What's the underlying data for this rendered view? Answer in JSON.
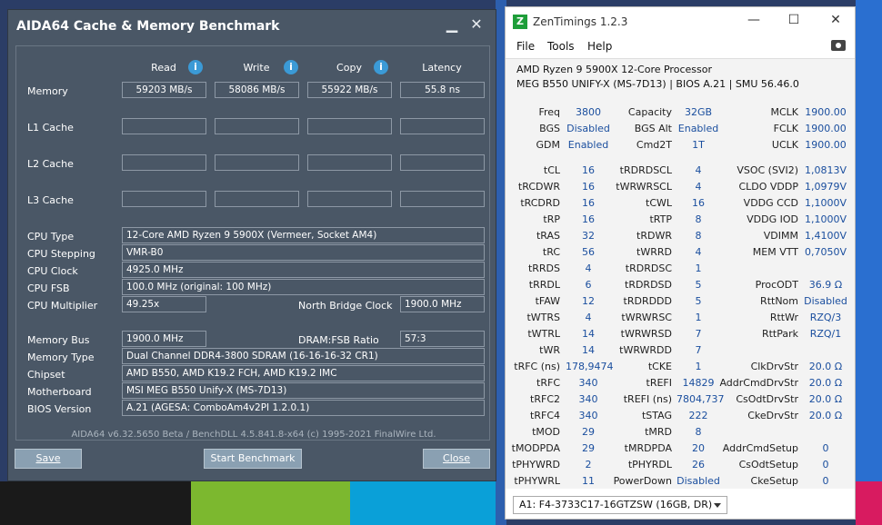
{
  "aida": {
    "title": "AIDA64 Cache & Memory Benchmark",
    "columns": [
      "Read",
      "Write",
      "Copy",
      "Latency"
    ],
    "rows": [
      {
        "label": "Memory",
        "values": [
          "59203 MB/s",
          "58086 MB/s",
          "55922 MB/s",
          "55.8 ns"
        ]
      },
      {
        "label": "L1 Cache",
        "values": [
          "",
          "",
          "",
          ""
        ]
      },
      {
        "label": "L2 Cache",
        "values": [
          "",
          "",
          "",
          ""
        ]
      },
      {
        "label": "L3 Cache",
        "values": [
          "",
          "",
          "",
          ""
        ]
      }
    ],
    "info": {
      "cpu_type_label": "CPU Type",
      "cpu_type": "12-Core AMD Ryzen 9 5900X  (Vermeer, Socket AM4)",
      "cpu_stepping_label": "CPU Stepping",
      "cpu_stepping": "VMR-B0",
      "cpu_clock_label": "CPU Clock",
      "cpu_clock": "4925.0 MHz",
      "cpu_fsb_label": "CPU FSB",
      "cpu_fsb": "100.0 MHz  (original: 100 MHz)",
      "cpu_multiplier_label": "CPU Multiplier",
      "cpu_multiplier": "49.25x",
      "nb_clock_label": "North Bridge Clock",
      "nb_clock": "1900.0 MHz",
      "memory_bus_label": "Memory Bus",
      "memory_bus": "1900.0 MHz",
      "dram_fsb_label": "DRAM:FSB Ratio",
      "dram_fsb": "57:3",
      "memory_type_label": "Memory Type",
      "memory_type": "Dual Channel DDR4-3800 SDRAM  (16-16-16-32 CR1)",
      "chipset_label": "Chipset",
      "chipset": "AMD B550, AMD K19.2 FCH, AMD K19.2 IMC",
      "motherboard_label": "Motherboard",
      "motherboard": "MSI MEG B550 Unify-X (MS-7D13)",
      "bios_label": "BIOS Version",
      "bios": "A.21  (AGESA: ComboAm4v2PI 1.2.0.1)"
    },
    "footer": "AIDA64 v6.32.5650 Beta / BenchDLL 4.5.841.8-x64  (c) 1995-2021 FinalWire Ltd.",
    "buttons": {
      "save": "Save",
      "start": "Start Benchmark",
      "close": "Close"
    }
  },
  "zen": {
    "title": "ZenTimings 1.2.3",
    "menu": [
      "File",
      "Tools",
      "Help"
    ],
    "cpu": "AMD Ryzen 9 5900X 12-Core Processor",
    "board": "MEG B550 UNIFY-X (MS-7D13) | BIOS A.21 | SMU 56.46.0",
    "col1": [
      [
        "Freq",
        "3800"
      ],
      [
        "BGS",
        "Disabled"
      ],
      [
        "GDM",
        "Enabled"
      ],
      [
        "",
        ""
      ],
      [
        "tCL",
        "16"
      ],
      [
        "tRCDWR",
        "16"
      ],
      [
        "tRCDRD",
        "16"
      ],
      [
        "tRP",
        "16"
      ],
      [
        "tRAS",
        "32"
      ],
      [
        "tRC",
        "56"
      ],
      [
        "tRRDS",
        "4"
      ],
      [
        "tRRDL",
        "6"
      ],
      [
        "tFAW",
        "12"
      ],
      [
        "tWTRS",
        "4"
      ],
      [
        "tWTRL",
        "14"
      ],
      [
        "tWR",
        "14"
      ],
      [
        "tRFC (ns)",
        "178,9474"
      ],
      [
        "tRFC",
        "340"
      ],
      [
        "tRFC2",
        "340"
      ],
      [
        "tRFC4",
        "340"
      ],
      [
        "tMOD",
        "29"
      ],
      [
        "tMODPDA",
        "29"
      ],
      [
        "tPHYWRD",
        "2"
      ],
      [
        "tPHYWRL",
        "11"
      ]
    ],
    "col2": [
      [
        "Capacity",
        "32GB"
      ],
      [
        "BGS Alt",
        "Enabled"
      ],
      [
        "Cmd2T",
        "1T"
      ],
      [
        "",
        ""
      ],
      [
        "tRDRDSCL",
        "4"
      ],
      [
        "tWRWRSCL",
        "4"
      ],
      [
        "tCWL",
        "16"
      ],
      [
        "tRTP",
        "8"
      ],
      [
        "tRDWR",
        "8"
      ],
      [
        "tWRRD",
        "4"
      ],
      [
        "tRDRDSC",
        "1"
      ],
      [
        "tRDRDSD",
        "5"
      ],
      [
        "tRDRDDD",
        "5"
      ],
      [
        "tWRWRSC",
        "1"
      ],
      [
        "tWRWRSD",
        "7"
      ],
      [
        "tWRWRDD",
        "7"
      ],
      [
        "tCKE",
        "1"
      ],
      [
        "tREFI",
        "14829"
      ],
      [
        "tREFI (ns)",
        "7804,737"
      ],
      [
        "tSTAG",
        "222"
      ],
      [
        "tMRD",
        "8"
      ],
      [
        "tMRDPDA",
        "20"
      ],
      [
        "tPHYRDL",
        "26"
      ],
      [
        "PowerDown",
        "Disabled"
      ]
    ],
    "col3": [
      [
        "MCLK",
        "1900.00"
      ],
      [
        "FCLK",
        "1900.00"
      ],
      [
        "UCLK",
        "1900.00"
      ],
      [
        "",
        ""
      ],
      [
        "VSOC (SVI2)",
        "1,0813V"
      ],
      [
        "CLDO VDDP",
        "1,0979V"
      ],
      [
        "VDDG CCD",
        "1,1000V"
      ],
      [
        "VDDG IOD",
        "1,1000V"
      ],
      [
        "VDIMM",
        "1,4100V"
      ],
      [
        "MEM VTT",
        "0,7050V"
      ],
      [
        "",
        ""
      ],
      [
        "ProcODT",
        "36.9 Ω"
      ],
      [
        "RttNom",
        "Disabled"
      ],
      [
        "RttWr",
        "RZQ/3"
      ],
      [
        "RttPark",
        "RZQ/1"
      ],
      [
        "",
        ""
      ],
      [
        "ClkDrvStr",
        "20.0 Ω"
      ],
      [
        "AddrCmdDrvStr",
        "20.0 Ω"
      ],
      [
        "CsOdtDrvStr",
        "20.0 Ω"
      ],
      [
        "CkeDrvStr",
        "20.0 Ω"
      ],
      [
        "",
        ""
      ],
      [
        "AddrCmdSetup",
        "0"
      ],
      [
        "CsOdtSetup",
        "0"
      ],
      [
        "CkeSetup",
        "0"
      ]
    ],
    "module": "A1: F4-3733C17-16GTZSW (16GB, DR)"
  }
}
